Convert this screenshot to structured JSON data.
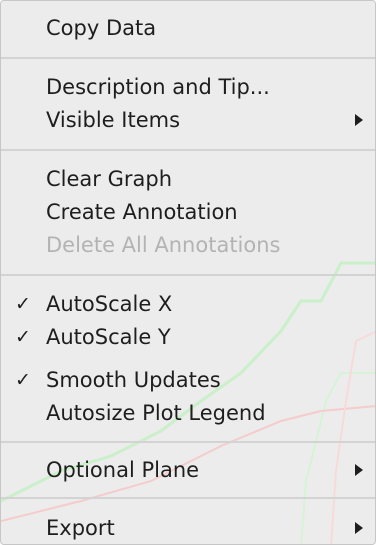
{
  "menu": {
    "copy_data": {
      "label": "Copy Data"
    },
    "description_and_tip": {
      "label": "Description and Tip..."
    },
    "visible_items": {
      "label": "Visible Items",
      "submenu_icon": "chevron-right-icon"
    },
    "clear_graph": {
      "label": "Clear Graph"
    },
    "create_annotation": {
      "label": "Create Annotation"
    },
    "delete_all_annotations": {
      "label": "Delete All Annotations",
      "enabled": false
    },
    "autoscale_x": {
      "label": "AutoScale X",
      "check": "✓",
      "checked": true
    },
    "autoscale_y": {
      "label": "AutoScale Y",
      "check": "✓",
      "checked": true
    },
    "smooth_updates": {
      "label": "Smooth Updates",
      "check": "✓",
      "checked": true
    },
    "autosize_plot_legend": {
      "label": "Autosize Plot Legend",
      "checked": false
    },
    "optional_plane": {
      "label": "Optional Plane",
      "submenu_icon": "chevron-right-icon"
    },
    "export": {
      "label": "Export",
      "submenu_icon": "chevron-right-icon"
    }
  },
  "colors": {
    "menu_background": "#ececec",
    "text": "#1e1e1e",
    "disabled_text": "#b3b3b3",
    "separator": "#d3d3d3",
    "bg_plot_green": "#c9f0c9",
    "bg_plot_red": "#f5cccc"
  }
}
